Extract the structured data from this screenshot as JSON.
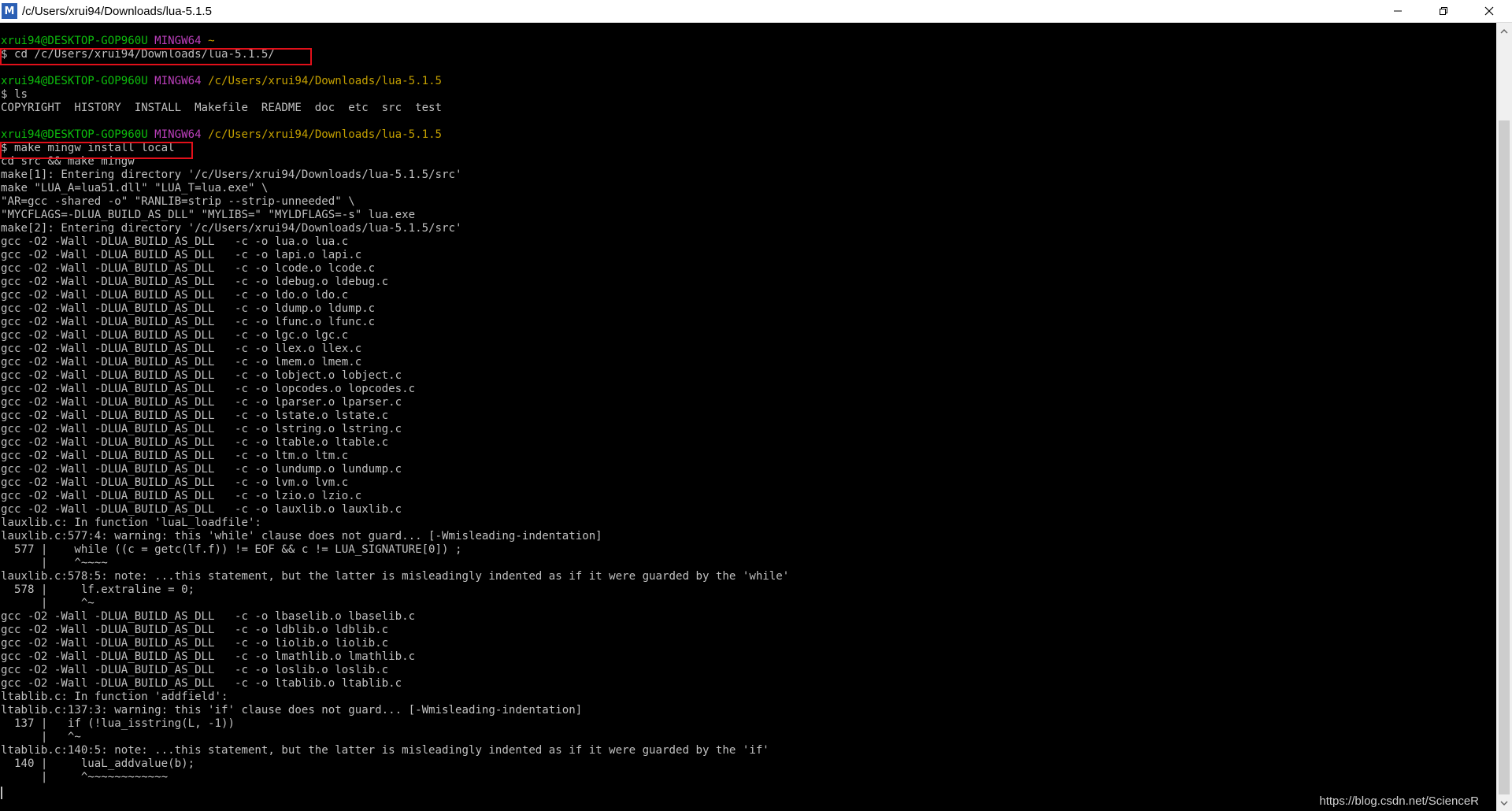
{
  "window": {
    "title": "/c/Users/xrui94/Downloads/lua-5.1.5",
    "app_icon": "M"
  },
  "watermark": "https://blog.csdn.net/ScienceR",
  "colors": {
    "green": "#0dbc0d",
    "magenta": "#bc3fbc",
    "yellow": "#c4a000",
    "text": "#c0c0c0",
    "highlight": "#e1101a"
  },
  "lines": [
    [
      {
        "t": "xrui94@DESKTOP-GOP960U ",
        "c": "green"
      },
      {
        "t": "MINGW64 ",
        "c": "magenta"
      },
      {
        "t": "~",
        "c": "yellow"
      }
    ],
    [
      {
        "t": "$ cd /c/Users/xrui94/Downloads/lua-5.1.5/"
      }
    ],
    [
      {
        "t": ""
      }
    ],
    [
      {
        "t": "xrui94@DESKTOP-GOP960U ",
        "c": "green"
      },
      {
        "t": "MINGW64 ",
        "c": "magenta"
      },
      {
        "t": "/c/Users/xrui94/Downloads/lua-5.1.5",
        "c": "yellow"
      }
    ],
    [
      {
        "t": "$ ls"
      }
    ],
    [
      {
        "t": "COPYRIGHT  HISTORY  INSTALL  Makefile  README  doc  etc  src  test"
      }
    ],
    [
      {
        "t": ""
      }
    ],
    [
      {
        "t": "xrui94@DESKTOP-GOP960U ",
        "c": "green"
      },
      {
        "t": "MINGW64 ",
        "c": "magenta"
      },
      {
        "t": "/c/Users/xrui94/Downloads/lua-5.1.5",
        "c": "yellow"
      }
    ],
    [
      {
        "t": "$ make mingw install local"
      }
    ],
    [
      {
        "t": "cd src && make mingw"
      }
    ],
    [
      {
        "t": "make[1]: Entering directory '/c/Users/xrui94/Downloads/lua-5.1.5/src'"
      }
    ],
    [
      {
        "t": "make \"LUA_A=lua51.dll\" \"LUA_T=lua.exe\" \\"
      }
    ],
    [
      {
        "t": "\"AR=gcc -shared -o\" \"RANLIB=strip --strip-unneeded\" \\"
      }
    ],
    [
      {
        "t": "\"MYCFLAGS=-DLUA_BUILD_AS_DLL\" \"MYLIBS=\" \"MYLDFLAGS=-s\" lua.exe"
      }
    ],
    [
      {
        "t": "make[2]: Entering directory '/c/Users/xrui94/Downloads/lua-5.1.5/src'"
      }
    ],
    [
      {
        "t": "gcc -O2 -Wall -DLUA_BUILD_AS_DLL   -c -o lua.o lua.c"
      }
    ],
    [
      {
        "t": "gcc -O2 -Wall -DLUA_BUILD_AS_DLL   -c -o lapi.o lapi.c"
      }
    ],
    [
      {
        "t": "gcc -O2 -Wall -DLUA_BUILD_AS_DLL   -c -o lcode.o lcode.c"
      }
    ],
    [
      {
        "t": "gcc -O2 -Wall -DLUA_BUILD_AS_DLL   -c -o ldebug.o ldebug.c"
      }
    ],
    [
      {
        "t": "gcc -O2 -Wall -DLUA_BUILD_AS_DLL   -c -o ldo.o ldo.c"
      }
    ],
    [
      {
        "t": "gcc -O2 -Wall -DLUA_BUILD_AS_DLL   -c -o ldump.o ldump.c"
      }
    ],
    [
      {
        "t": "gcc -O2 -Wall -DLUA_BUILD_AS_DLL   -c -o lfunc.o lfunc.c"
      }
    ],
    [
      {
        "t": "gcc -O2 -Wall -DLUA_BUILD_AS_DLL   -c -o lgc.o lgc.c"
      }
    ],
    [
      {
        "t": "gcc -O2 -Wall -DLUA_BUILD_AS_DLL   -c -o llex.o llex.c"
      }
    ],
    [
      {
        "t": "gcc -O2 -Wall -DLUA_BUILD_AS_DLL   -c -o lmem.o lmem.c"
      }
    ],
    [
      {
        "t": "gcc -O2 -Wall -DLUA_BUILD_AS_DLL   -c -o lobject.o lobject.c"
      }
    ],
    [
      {
        "t": "gcc -O2 -Wall -DLUA_BUILD_AS_DLL   -c -o lopcodes.o lopcodes.c"
      }
    ],
    [
      {
        "t": "gcc -O2 -Wall -DLUA_BUILD_AS_DLL   -c -o lparser.o lparser.c"
      }
    ],
    [
      {
        "t": "gcc -O2 -Wall -DLUA_BUILD_AS_DLL   -c -o lstate.o lstate.c"
      }
    ],
    [
      {
        "t": "gcc -O2 -Wall -DLUA_BUILD_AS_DLL   -c -o lstring.o lstring.c"
      }
    ],
    [
      {
        "t": "gcc -O2 -Wall -DLUA_BUILD_AS_DLL   -c -o ltable.o ltable.c"
      }
    ],
    [
      {
        "t": "gcc -O2 -Wall -DLUA_BUILD_AS_DLL   -c -o ltm.o ltm.c"
      }
    ],
    [
      {
        "t": "gcc -O2 -Wall -DLUA_BUILD_AS_DLL   -c -o lundump.o lundump.c"
      }
    ],
    [
      {
        "t": "gcc -O2 -Wall -DLUA_BUILD_AS_DLL   -c -o lvm.o lvm.c"
      }
    ],
    [
      {
        "t": "gcc -O2 -Wall -DLUA_BUILD_AS_DLL   -c -o lzio.o lzio.c"
      }
    ],
    [
      {
        "t": "gcc -O2 -Wall -DLUA_BUILD_AS_DLL   -c -o lauxlib.o lauxlib.c"
      }
    ],
    [
      {
        "t": "lauxlib.c: In function 'luaL_loadfile':"
      }
    ],
    [
      {
        "t": "lauxlib.c:577:4: warning: this 'while' clause does not guard... [-Wmisleading-indentation]"
      }
    ],
    [
      {
        "t": "  577 |    while ((c = getc(lf.f)) != EOF && c != LUA_SIGNATURE[0]) ;"
      }
    ],
    [
      {
        "t": "      |    ^~~~~"
      }
    ],
    [
      {
        "t": "lauxlib.c:578:5: note: ...this statement, but the latter is misleadingly indented as if it were guarded by the 'while'"
      }
    ],
    [
      {
        "t": "  578 |     lf.extraline = 0;"
      }
    ],
    [
      {
        "t": "      |     ^~"
      }
    ],
    [
      {
        "t": "gcc -O2 -Wall -DLUA_BUILD_AS_DLL   -c -o lbaselib.o lbaselib.c"
      }
    ],
    [
      {
        "t": "gcc -O2 -Wall -DLUA_BUILD_AS_DLL   -c -o ldblib.o ldblib.c"
      }
    ],
    [
      {
        "t": "gcc -O2 -Wall -DLUA_BUILD_AS_DLL   -c -o liolib.o liolib.c"
      }
    ],
    [
      {
        "t": "gcc -O2 -Wall -DLUA_BUILD_AS_DLL   -c -o lmathlib.o lmathlib.c"
      }
    ],
    [
      {
        "t": "gcc -O2 -Wall -DLUA_BUILD_AS_DLL   -c -o loslib.o loslib.c"
      }
    ],
    [
      {
        "t": "gcc -O2 -Wall -DLUA_BUILD_AS_DLL   -c -o ltablib.o ltablib.c"
      }
    ],
    [
      {
        "t": "ltablib.c: In function 'addfield':"
      }
    ],
    [
      {
        "t": "ltablib.c:137:3: warning: this 'if' clause does not guard... [-Wmisleading-indentation]"
      }
    ],
    [
      {
        "t": "  137 |   if (!lua_isstring(L, -1))"
      }
    ],
    [
      {
        "t": "      |   ^~"
      }
    ],
    [
      {
        "t": "ltablib.c:140:5: note: ...this statement, but the latter is misleadingly indented as if it were guarded by the 'if'"
      }
    ],
    [
      {
        "t": "  140 |     luaL_addvalue(b);"
      }
    ],
    [
      {
        "t": "      |     ^~~~~~~~~~~~~"
      }
    ]
  ]
}
